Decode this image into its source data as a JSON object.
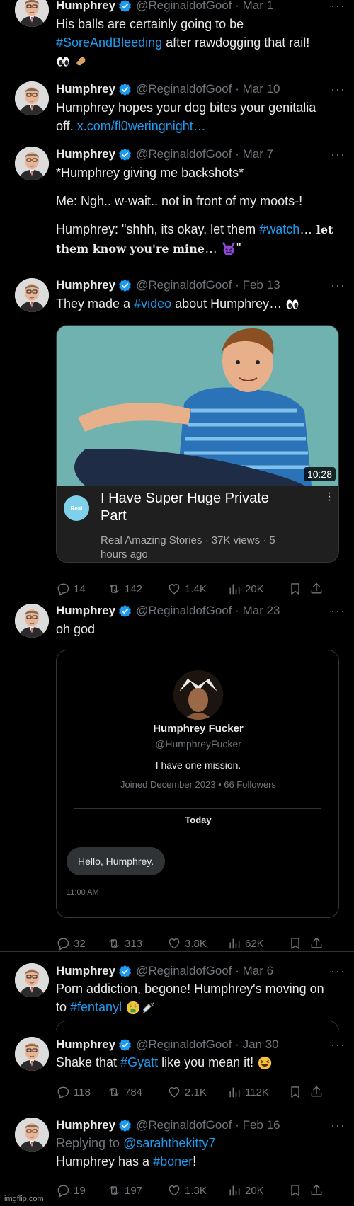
{
  "tweets": [
    {
      "name": "Humphrey",
      "handle": "@ReginaldofGoof",
      "date": "Mar 1",
      "line1": "His balls are certainly going to be",
      "tag1": "#SoreAndBleeding",
      "line2_after": " after rawdogging that rail!",
      "emoji_icons": [
        "eyes-icon",
        "peanut-icon"
      ]
    },
    {
      "name": "Humphrey",
      "handle": "@ReginaldofGoof",
      "date": "Mar 10",
      "line1": "Humphrey hopes your dog bites your genitalia",
      "line2_before": "off. ",
      "link": "x.com/fl0weringnight…"
    },
    {
      "name": "Humphrey",
      "handle": "@ReginaldofGoof",
      "date": "Mar 7",
      "line1": "*Humphrey giving me backshots*",
      "line2": "Me: Ngh.. w-wait.. not in front of my moots-!",
      "line3_before": "Humphrey: \"shhh, its okay, let them ",
      "tag": "#watch",
      "line3_after": "…",
      "line3_serif": " let",
      "line4_serif": "them know you're mine",
      "line4_after": "… ",
      "line4_end": "\""
    },
    {
      "name": "Humphrey",
      "handle": "@ReginaldofGoof",
      "date": "Feb 13",
      "text_before": "They made a ",
      "tag": "#video",
      "text_after": " about Humphrey… ",
      "video": {
        "duration": "10:28",
        "title_line1": "I Have Super Huge Private",
        "title_line2": "Part",
        "meta_line1": "Real Amazing Stories · 37K views · 5",
        "meta_line2": "hours ago",
        "channel_icon_text": "Real"
      },
      "stats": {
        "replies": "14",
        "retweets": "142",
        "likes": "1.4K",
        "views": "20K"
      }
    },
    {
      "name": "Humphrey",
      "handle": "@ReginaldofGoof",
      "date": "Mar 23",
      "text": "oh god",
      "dm_card": {
        "display_name": "Humphrey Fucker",
        "username": "@HumphreyFucker",
        "bio": "I have one mission.",
        "joined": "Joined December 2023 • 66 Followers",
        "day": "Today",
        "message": "Hello, Humphrey.",
        "time": "11:00 AM"
      },
      "stats": {
        "replies": "32",
        "retweets": "313",
        "likes": "3.8K",
        "views": "62K"
      }
    },
    {
      "name": "Humphrey",
      "handle": "@ReginaldofGoof",
      "date": "Mar 6",
      "line1": "Porn addiction, begone! Humphrey's moving on",
      "line2_before": "to ",
      "tag": "#fentanyl"
    },
    {
      "name": "Humphrey",
      "handle": "@ReginaldofGoof",
      "date": "Jan 30",
      "text_before": "Shake that ",
      "tag": "#Gyatt",
      "text_after": " like you mean it! ",
      "stats": {
        "replies": "118",
        "retweets": "784",
        "likes": "2.1K",
        "views": "112K"
      }
    },
    {
      "name": "Humphrey",
      "handle": "@ReginaldofGoof",
      "date": "Feb 16",
      "reply_prefix": "Replying to ",
      "reply_to": "@sarahthekitty7",
      "text_before": "Humphrey has a ",
      "tag": "#boner",
      "text_after": "!",
      "stats": {
        "replies": "19",
        "retweets": "197",
        "likes": "1.3K",
        "views": "20K"
      }
    }
  ],
  "watermark": "imgflip.com",
  "colors": {
    "link": "#1d9bf0",
    "muted": "#71767b",
    "text": "#e7e9ea",
    "background": "#000000",
    "verified": "#1d9bf0"
  }
}
